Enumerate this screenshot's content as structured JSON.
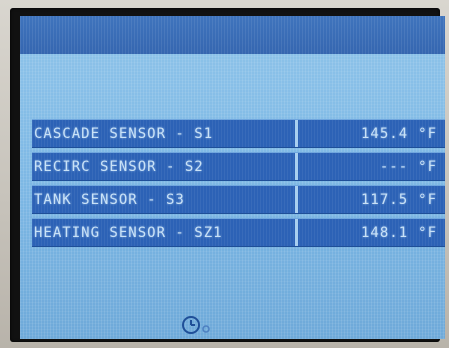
{
  "sensors": [
    {
      "name": "CASCADE SENSOR - S1",
      "value": "145.4",
      "unit": "°F"
    },
    {
      "name": "RECIRC SENSOR - S2",
      "value": "---",
      "unit": "°F"
    },
    {
      "name": "TANK SENSOR - S3",
      "value": "117.5",
      "unit": "°F"
    },
    {
      "name": "HEATING SENSOR - SZ1",
      "value": "148.1",
      "unit": "°F"
    }
  ],
  "status_icon": "clock-icon",
  "colors": {
    "screen_background": "#7cb7e4",
    "header_band": "#3566b0",
    "row_background": "#2c62b6",
    "lcd_text": "#c9e2f7"
  }
}
